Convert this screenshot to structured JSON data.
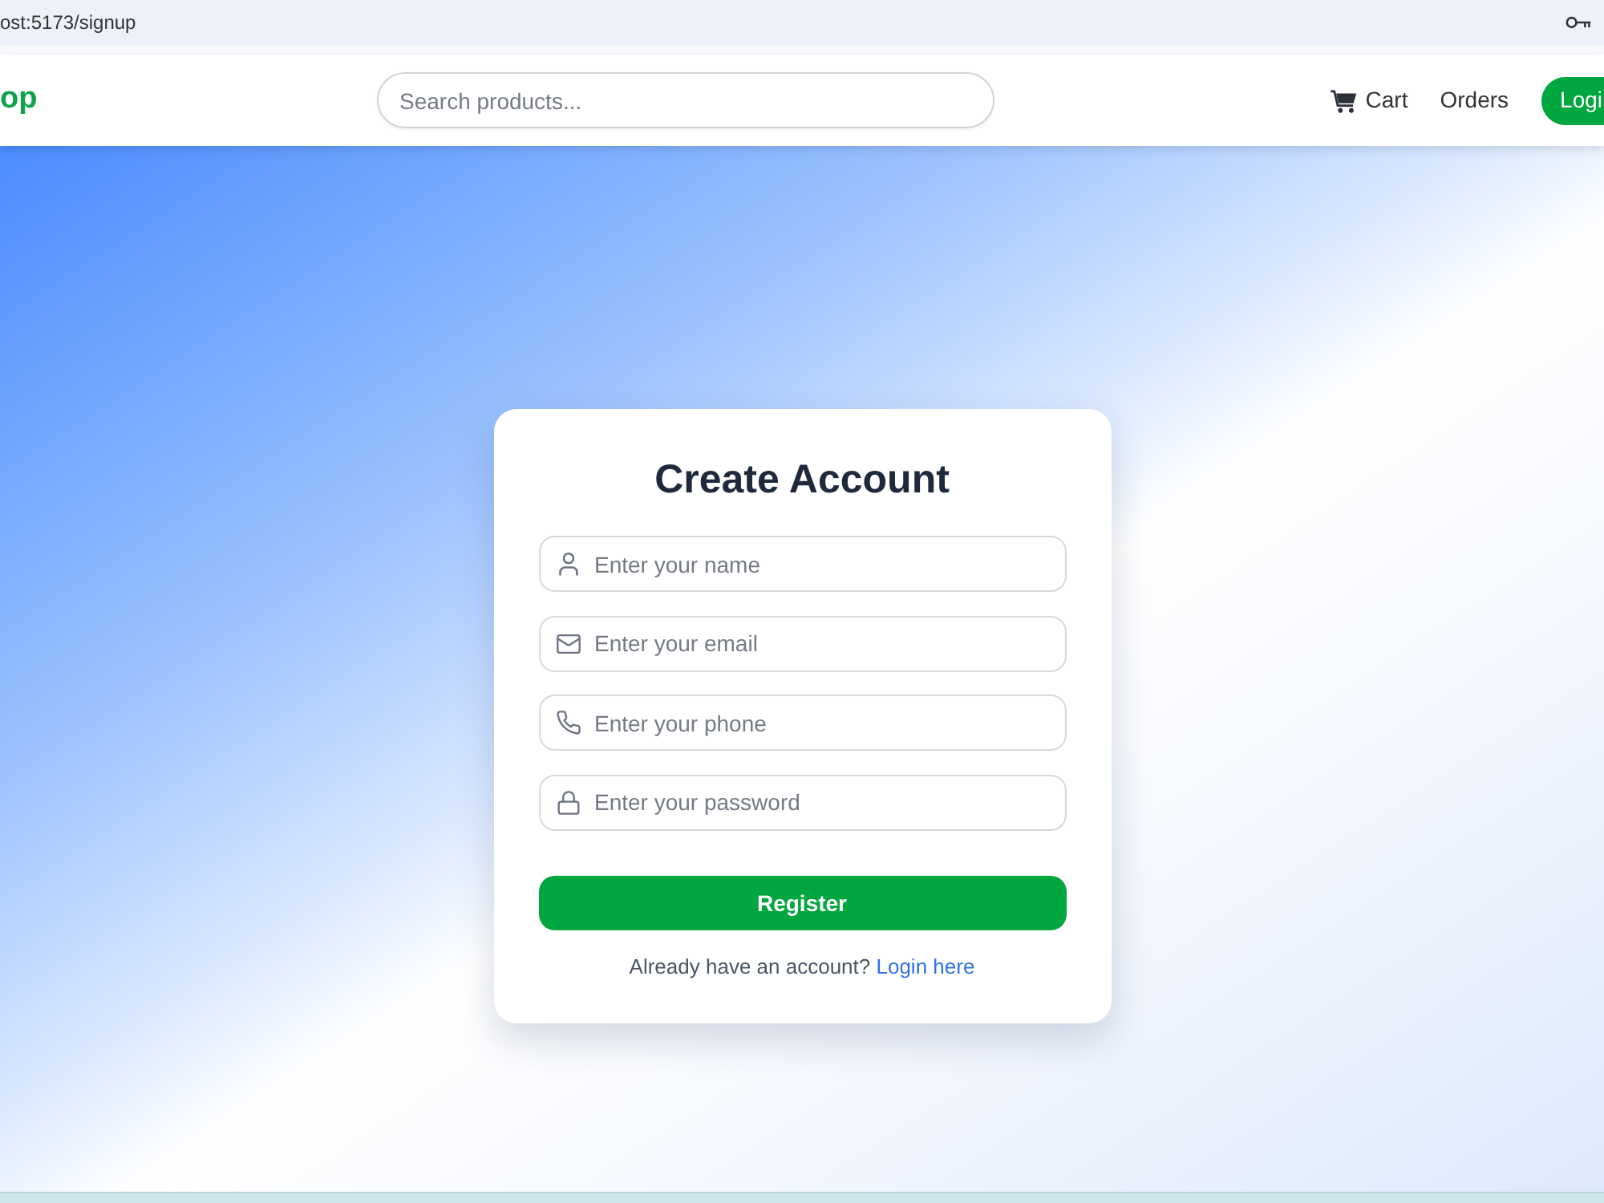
{
  "browser": {
    "url": "ost:5173/signup"
  },
  "navbar": {
    "logo": "op",
    "search": {
      "placeholder": "Search products..."
    },
    "links": [
      {
        "kind": "cart",
        "label": "Cart"
      },
      {
        "kind": "link",
        "label": "Orders"
      },
      {
        "kind": "button",
        "label": "Logi"
      }
    ]
  },
  "signup_card": {
    "title": "Create Account",
    "fields": [
      {
        "kind": "name",
        "placeholder": "Enter your name"
      },
      {
        "kind": "email",
        "placeholder": "Enter your email"
      },
      {
        "kind": "phone",
        "placeholder": "Enter your phone"
      },
      {
        "kind": "password",
        "placeholder": "Enter your password"
      }
    ],
    "submit": "Register",
    "footer": {
      "text": "Already have an account?",
      "link": "Login here"
    }
  }
}
